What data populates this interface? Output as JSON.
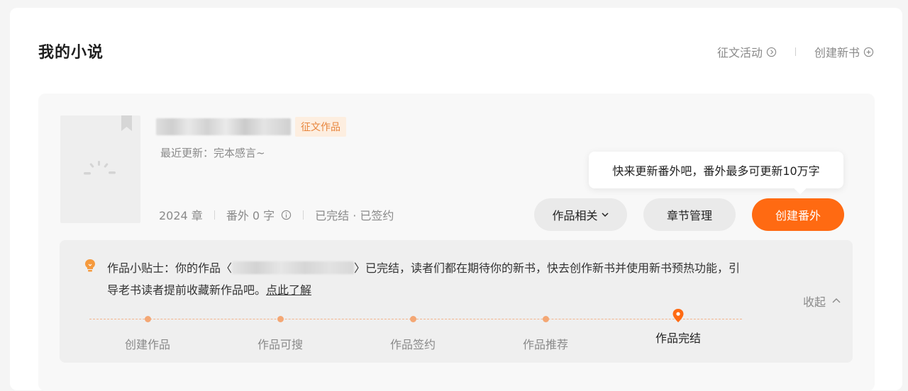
{
  "header": {
    "title": "我的小说",
    "contest_label": "征文活动",
    "new_book_label": "创建新书"
  },
  "book": {
    "tag": "征文作品",
    "recent_update": "最近更新：完本感言~",
    "chapters": "2024 章",
    "extra_words": "番外 0 字",
    "status": "已完结 · 已签约"
  },
  "buttons": {
    "works": "作品相关",
    "chapters": "章节管理",
    "create_extra": "创建番外"
  },
  "tooltip": "快来更新番外吧，番外最多可更新10万字",
  "tips": {
    "prefix": "作品小贴士：你的作品〈",
    "suffix": "〉已完结，读者们都在期待你的新书，快去创作新书并使用新书预热功能，引导老书读者提前收藏新作品吧。",
    "link": "点此了解",
    "collapse": "收起"
  },
  "steps": [
    {
      "label": "创建作品"
    },
    {
      "label": "作品可搜"
    },
    {
      "label": "作品签约"
    },
    {
      "label": "作品推荐"
    },
    {
      "label": "作品完结"
    }
  ],
  "colors": {
    "accent": "#ff6a12",
    "tag_bg": "#fdeee0",
    "tag_text": "#e8853c",
    "step_dot": "#f4a774"
  }
}
